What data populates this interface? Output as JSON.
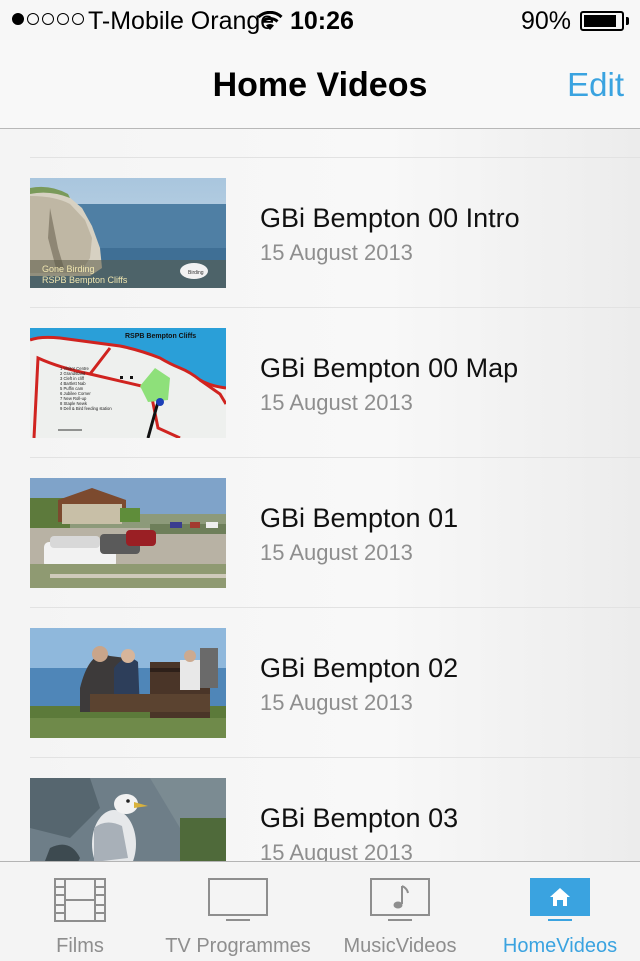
{
  "status_bar": {
    "carrier": "T-Mobile Orange",
    "time": "10:26",
    "battery": "90%",
    "signal_dots_filled": 1,
    "signal_dots_total": 5
  },
  "nav": {
    "title": "Home Videos",
    "edit_label": "Edit",
    "accent_color": "#3aa3e0"
  },
  "videos": [
    {
      "title": "GBi Bempton 00 Intro",
      "date": "15 August 2013",
      "thumb_caption_1": "Gone Birding",
      "thumb_caption_2": "RSPB Bempton Cliffs",
      "thumb_badge": "Birding"
    },
    {
      "title": "GBi Bempton 00 Map",
      "date": "15 August 2013",
      "map_title": "RSPB Bempton Cliffs",
      "map_legend": [
        "1 Visitor Centre",
        "2 Grandstand",
        "3 Cleft in cliff",
        "4 Bartlett Nab",
        "5 Puffin cam",
        "6 Jubilee Corner",
        "7 New Roll-up",
        "8 Staple Newk",
        "9 Dell & Bird feeding station"
      ]
    },
    {
      "title": "GBi Bempton 01",
      "date": "15 August 2013"
    },
    {
      "title": "GBi Bempton 02",
      "date": "15 August 2013"
    },
    {
      "title": "GBi Bempton 03",
      "date": "15 August 2013"
    }
  ],
  "tabs": [
    {
      "label": "Films",
      "icon": "film-icon",
      "active": false
    },
    {
      "label": "TV Programmes",
      "icon": "tv-icon",
      "active": false
    },
    {
      "label": "MusicVideos",
      "icon": "music-video-icon",
      "active": false
    },
    {
      "label": "HomeVideos",
      "icon": "home-icon",
      "active": true
    }
  ]
}
